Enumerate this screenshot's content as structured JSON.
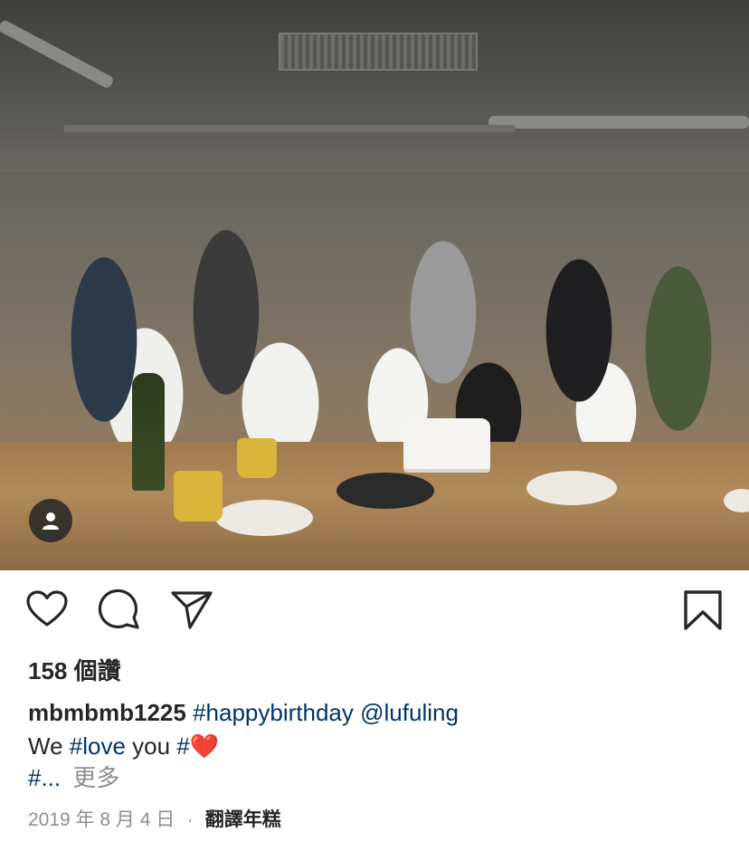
{
  "photo": {
    "description_icon": "person-icon"
  },
  "actions": {
    "like_icon": "heart-icon",
    "comment_icon": "comment-icon",
    "share_icon": "send-icon",
    "save_icon": "bookmark-icon"
  },
  "likes": {
    "text": "158 個讚"
  },
  "caption": {
    "username": "mbmbmb1225",
    "tag1": "#happybirthday",
    "mention": "@lufuling",
    "line2_prefix": "We ",
    "tag2": "#love",
    "line2_mid": " you ",
    "line2_hash": "#",
    "heart_emoji": "❤️",
    "line3_tag": "#...",
    "more": "更多"
  },
  "footer": {
    "date": "2019 年 8 月 4 日",
    "separator": "·",
    "translate": "翻譯年糕"
  }
}
